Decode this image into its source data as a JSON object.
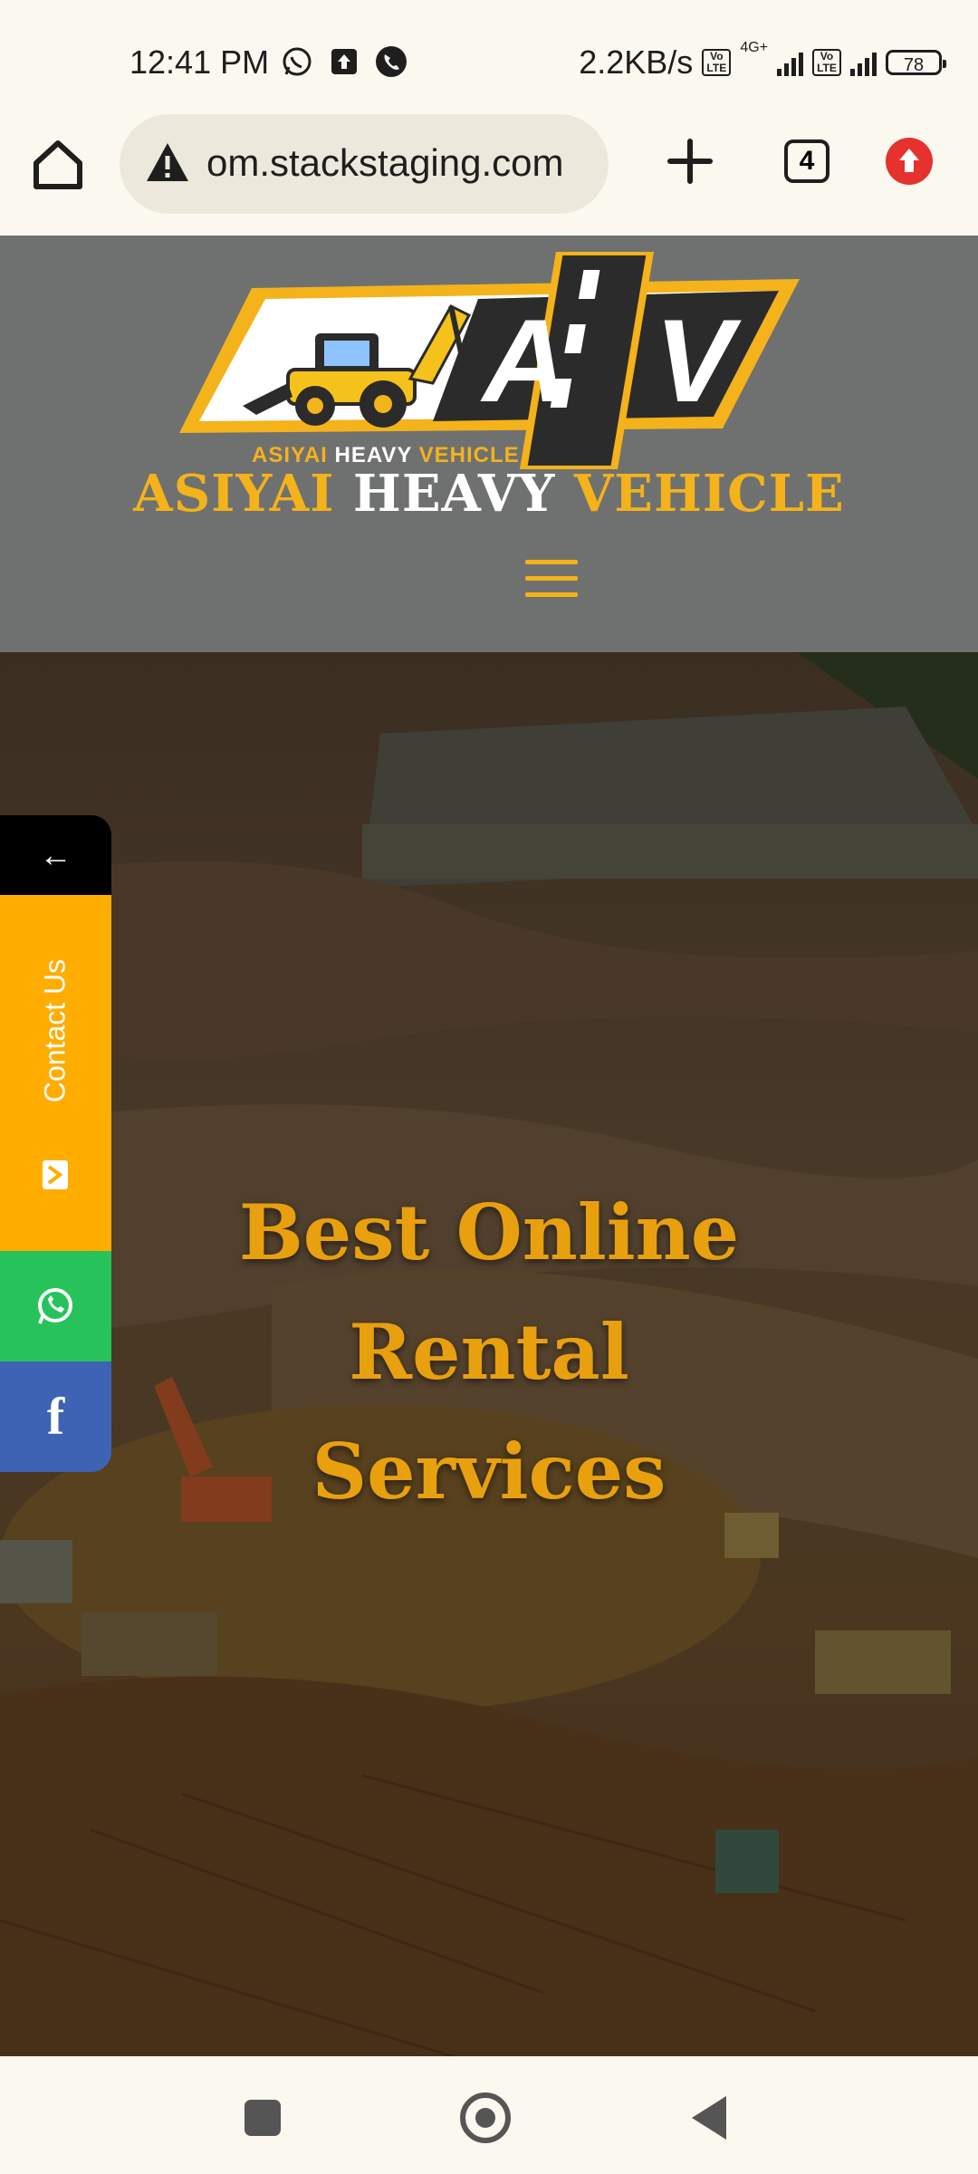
{
  "status_bar": {
    "time": "12:41 PM",
    "speed": "2.2KB/s",
    "network_label": "4G+",
    "volte_label": "Vo\nLTE",
    "battery": "78"
  },
  "browser": {
    "url": "om.stackstaging.com",
    "tab_count": "4"
  },
  "site": {
    "logo_tagline": {
      "part1": "ASIYAI",
      "part2": "HEAVY",
      "part3": "VEHICLE"
    },
    "logo_letters": "AHV",
    "brand": {
      "part1": "ASIYAI",
      "part2": "HEAVY",
      "part3": "VEHICLE"
    }
  },
  "hero": {
    "title_line1": "Best Online",
    "title_line2": "Rental",
    "title_line3": "Services"
  },
  "side_panel": {
    "arrow": "←",
    "contact_label": "Contact Us",
    "facebook": "f"
  },
  "colors": {
    "accent": "#f4b21b",
    "header_bg": "#6f7170",
    "contact_bg": "#ffad00",
    "whatsapp_bg": "#27c35a",
    "facebook_bg": "#3e63b4"
  }
}
